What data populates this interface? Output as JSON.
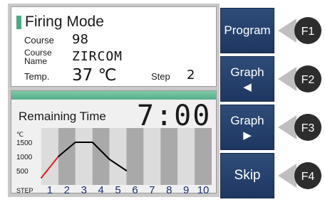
{
  "info": {
    "title": "Firing Mode",
    "course_label": "Course",
    "course_value": "98",
    "course_name_label_1": "Course",
    "course_name_label_2": "Name",
    "course_name_value": "ZIRCOM",
    "temp_label": "Temp.",
    "temp_value": "37 ℃",
    "step_label": "Step",
    "step_value": "2"
  },
  "time": {
    "label": "Remaining Time",
    "value": "7:00"
  },
  "graph": {
    "unit": "℃",
    "y_ticks": [
      "1500",
      "1000",
      "500"
    ],
    "step_label": "STEP",
    "steps": [
      "1",
      "2",
      "3",
      "4",
      "5",
      "6",
      "7",
      "8",
      "9",
      "10"
    ]
  },
  "chart_data": {
    "type": "line",
    "x": [
      1,
      2,
      3,
      4,
      5,
      6
    ],
    "series": [
      {
        "values": [
          250,
          1000,
          1500,
          1500,
          900,
          500
        ]
      }
    ],
    "completed_up_to_step": 2,
    "ylim": [
      0,
      2000
    ]
  },
  "buttons": [
    {
      "label": "Program",
      "arrow": ""
    },
    {
      "label": "Graph",
      "arrow": "◀"
    },
    {
      "label": "Graph",
      "arrow": "▶"
    },
    {
      "label": "Skip",
      "arrow": ""
    }
  ],
  "fkeys": [
    "F1",
    "F2",
    "F3",
    "F4"
  ],
  "colors": {
    "button_blue": "#1e3761",
    "accent_green": "#56ae8a",
    "progress_red": "#e02020",
    "fkey_dark": "#2d2d2d"
  }
}
